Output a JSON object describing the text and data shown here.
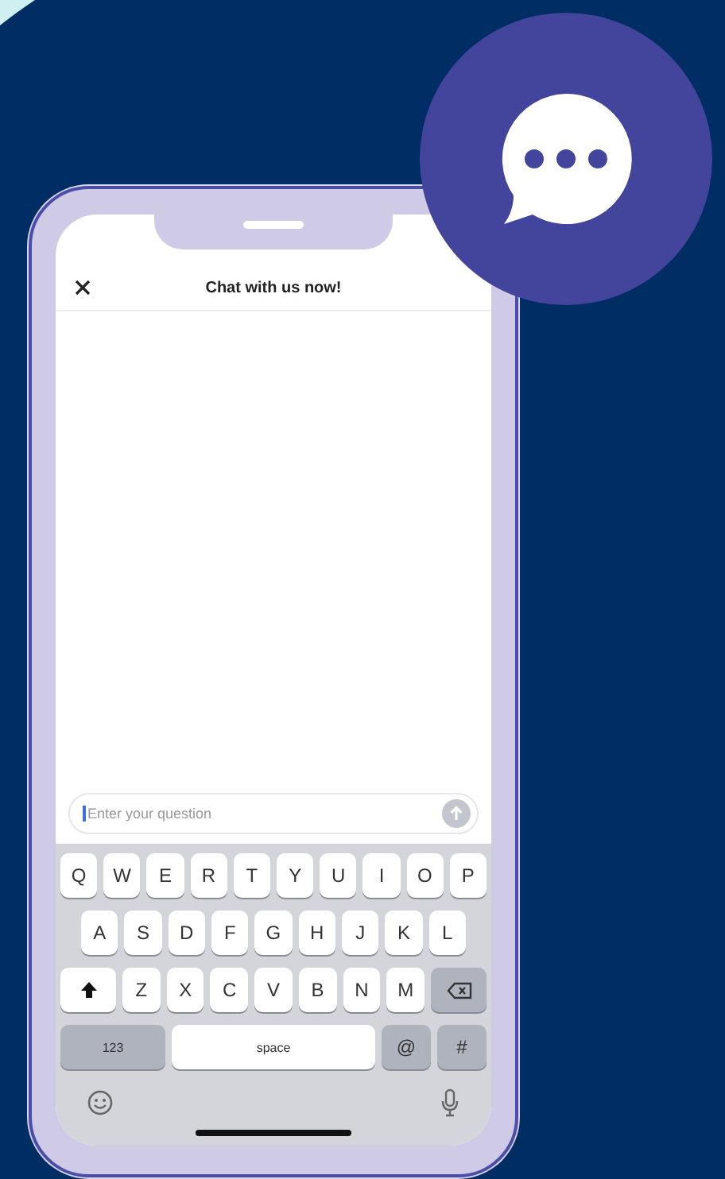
{
  "chat": {
    "title": "Chat with us now!"
  },
  "composer": {
    "placeholder": "Enter your question"
  },
  "keyboard": {
    "rows": [
      {
        "keys": [
          {
            "kind": "letter",
            "label": "Q"
          },
          {
            "kind": "letter",
            "label": "W"
          },
          {
            "kind": "letter",
            "label": "E"
          },
          {
            "kind": "letter",
            "label": "R"
          },
          {
            "kind": "letter",
            "label": "T"
          },
          {
            "kind": "letter",
            "label": "Y"
          },
          {
            "kind": "letter",
            "label": "U"
          },
          {
            "kind": "letter",
            "label": "I"
          },
          {
            "kind": "letter",
            "label": "O"
          },
          {
            "kind": "letter",
            "label": "P"
          }
        ]
      },
      {
        "keys": [
          {
            "kind": "letter",
            "label": "A"
          },
          {
            "kind": "letter",
            "label": "S"
          },
          {
            "kind": "letter",
            "label": "D"
          },
          {
            "kind": "letter",
            "label": "F"
          },
          {
            "kind": "letter",
            "label": "G"
          },
          {
            "kind": "letter",
            "label": "H"
          },
          {
            "kind": "letter",
            "label": "J"
          },
          {
            "kind": "letter",
            "label": "K"
          },
          {
            "kind": "letter",
            "label": "L"
          }
        ]
      },
      {
        "keys": [
          {
            "kind": "shift"
          },
          {
            "kind": "letter",
            "label": "Z"
          },
          {
            "kind": "letter",
            "label": "X"
          },
          {
            "kind": "letter",
            "label": "C"
          },
          {
            "kind": "letter",
            "label": "V"
          },
          {
            "kind": "letter",
            "label": "B"
          },
          {
            "kind": "letter",
            "label": "N"
          },
          {
            "kind": "letter",
            "label": "M"
          },
          {
            "kind": "backspace"
          }
        ]
      },
      {
        "keys": [
          {
            "kind": "mode",
            "label": "123"
          },
          {
            "kind": "space",
            "label": "space"
          },
          {
            "kind": "symbol",
            "label": "@"
          },
          {
            "kind": "symbol",
            "label": "#"
          }
        ]
      }
    ]
  }
}
